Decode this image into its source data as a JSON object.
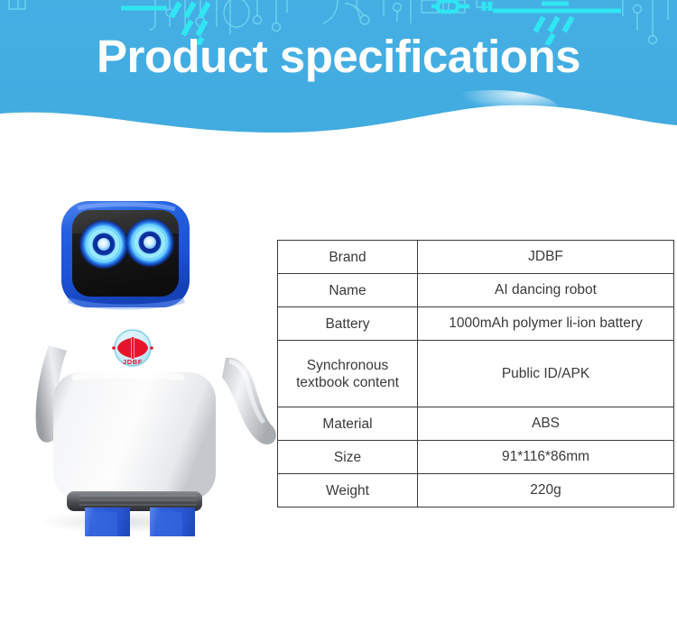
{
  "header": {
    "title": "Product specifications",
    "background_color": "#42ADE2",
    "wave_color": "#FFFFFF",
    "circuit_line_color": "#6ED3EE",
    "circuit_accent_color": "#2FE5F2",
    "decor_name": "circuit-board-pattern"
  },
  "product_image": {
    "name": "ai-dancing-robot-photo",
    "alt": "AI dancing robot",
    "logo_text": "JDBF",
    "body_color": "#F2F3F5",
    "accent_color": "#2E5FD9",
    "head_color": "#1E56D6",
    "screen_color": "#1C1C1C",
    "eye_color": "#1F86F0"
  },
  "spec_table": {
    "name": "product-specifications-table",
    "border_color": "#3B3B3B",
    "text_color": "#3A3A3A",
    "rows": [
      {
        "label": "Brand",
        "value": "JDBF",
        "tall": false
      },
      {
        "label": "Name",
        "value": "AI dancing robot",
        "tall": false
      },
      {
        "label": "Battery",
        "value": "1000mAh polymer li-ion battery",
        "tall": false
      },
      {
        "label": "Synchronous\ntextbook content",
        "label_line1": "Synchronous",
        "label_line2": "textbook content",
        "value": "Public ID/APK",
        "tall": true
      },
      {
        "label": "Material",
        "value": "ABS",
        "tall": false
      },
      {
        "label": "Size",
        "value": "91*116*86mm",
        "tall": false
      },
      {
        "label": "Weight",
        "value": "220g",
        "tall": false
      }
    ]
  }
}
